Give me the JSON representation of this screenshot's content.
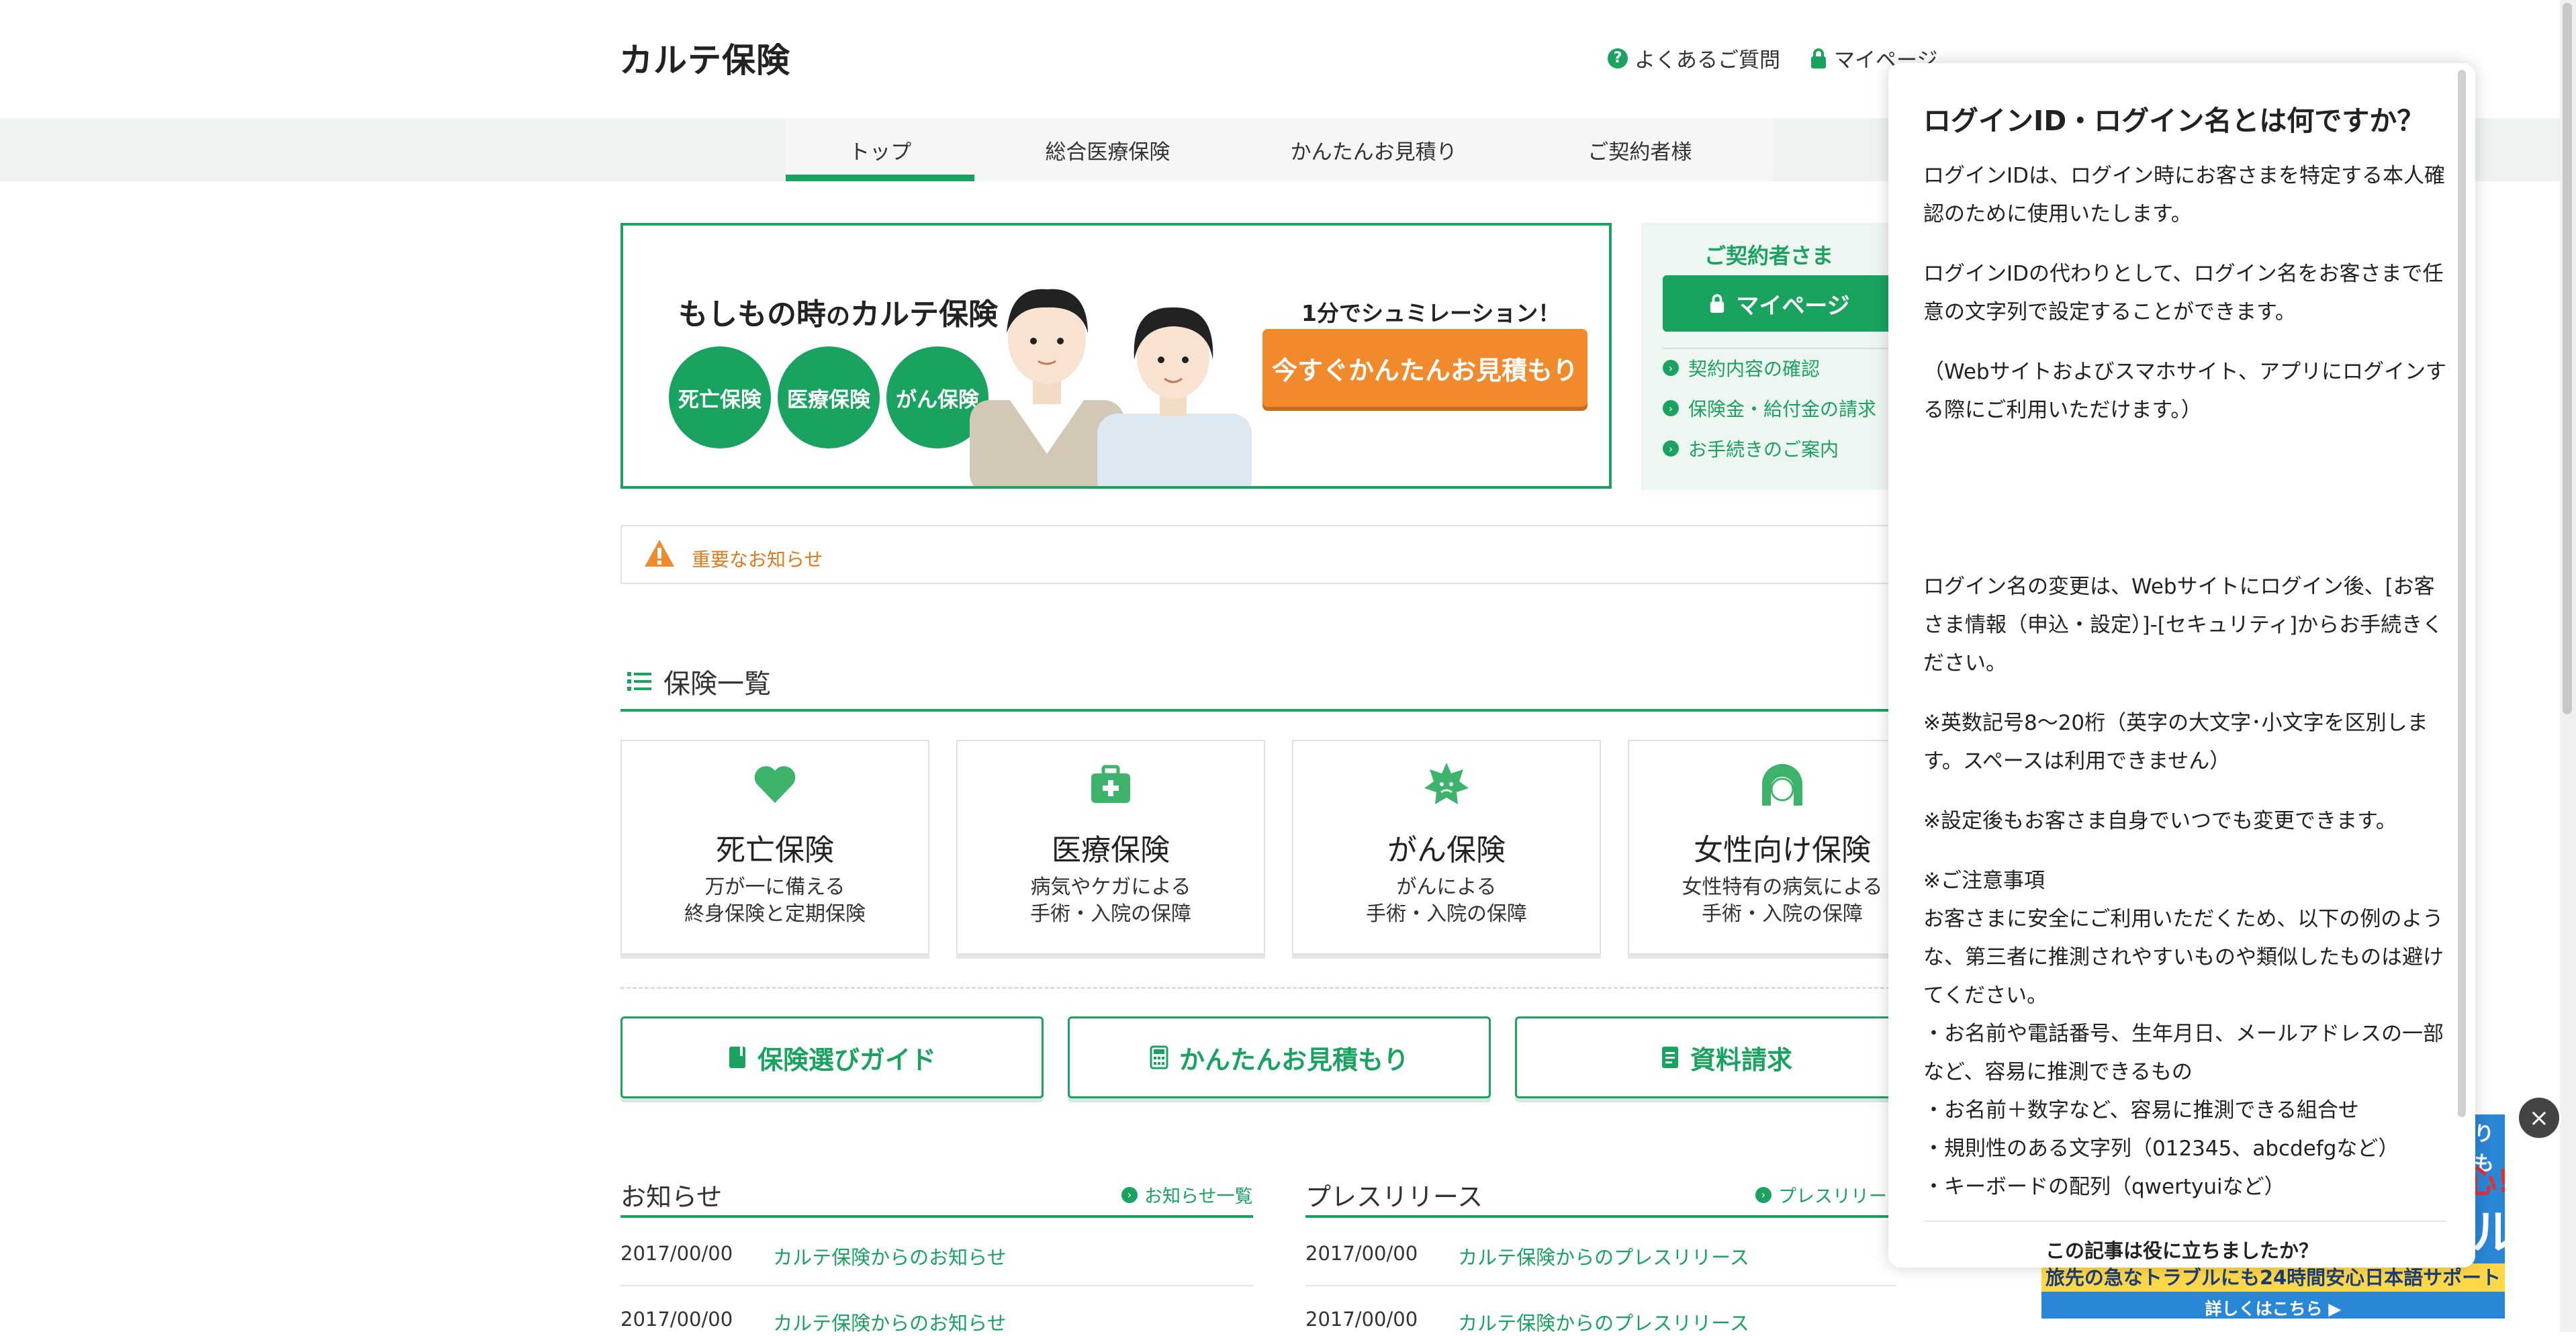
{
  "header": {
    "logo": "カルテ保険",
    "faq": "よくあるご質問",
    "mypage": "マイページ"
  },
  "nav": {
    "tabs": [
      "トップ",
      "総合医療保険",
      "かんたんお見積り",
      "ご契約者様"
    ],
    "active": "トップ"
  },
  "hero": {
    "title_a": "もしもの時",
    "title_b": "の",
    "title_c": "カルテ保険",
    "circles": [
      "死亡保険",
      "医療保険",
      "がん保険"
    ],
    "sim_label": "1分でシュミレーション！",
    "estimate_button": "今すぐかんたんお見積もり"
  },
  "member": {
    "title": "ご契約者さま",
    "mypage_button": "マイページ",
    "links": [
      "契約内容の確認",
      "保険金・給付金の請求",
      "お手続きのご案内"
    ]
  },
  "notice": {
    "text": "重要なお知らせ"
  },
  "insurance_list": {
    "title": "保険一覧",
    "cards": [
      {
        "icon": "heart-icon",
        "title": "死亡保険",
        "desc1": "万が一に備える",
        "desc2": "終身保険と定期保険"
      },
      {
        "icon": "medical-kit-icon",
        "title": "医療保険",
        "desc1": "病気やケガによる",
        "desc2": "手術・入院の保障"
      },
      {
        "icon": "cancer-icon",
        "title": "がん保険",
        "desc1": "がんによる",
        "desc2": "手術・入院の保障"
      },
      {
        "icon": "woman-icon",
        "title": "女性向け保険",
        "desc1": "女性特有の病気による",
        "desc2": "手術・入院の保障"
      }
    ]
  },
  "guides": [
    "保険選びガイド",
    "かんたんお見積もり",
    "資料請求"
  ],
  "news": {
    "title": "お知らせ",
    "more": "お知らせ一覧",
    "rows": [
      {
        "date": "2017/00/00",
        "text": "カルテ保険からのお知らせ"
      },
      {
        "date": "2017/00/00",
        "text": "カルテ保険からのお知らせ"
      }
    ]
  },
  "press": {
    "title": "プレスリリース",
    "more": "プレスリリース",
    "rows": [
      {
        "date": "2017/00/00",
        "text": "カルテ保険からのプレスリリース"
      },
      {
        "date": "2017/00/00",
        "text": "カルテ保険からのプレスリリース"
      }
    ]
  },
  "help_panel": {
    "title": "ログインID・ログイン名とは何ですか？",
    "p1": "ログインIDは、ログイン時にお客さまを特定する本人確認のために使用いたします。",
    "p2": "ログインIDの代わりとして、ログイン名をお客さまで任意の文字列で設定することができます。",
    "p3": "（Webサイトおよびスマホサイト、アプリにログインする際にご利用いただけます。）",
    "p4": "ログイン名の変更は、Webサイトにログイン後、[お客さま情報（申込・設定）]-[セキュリティ]からお手続きください。",
    "p5": "※英数記号8〜20桁（英字の大文字･小文字を区別します。スペースは利用できません）",
    "p6": "※設定後もお客さま自身でいつでも変更できます。",
    "caution_title": "※ご注意事項",
    "caution_body": "お客さまに安全にご利用いただくため、以下の例のような、第三者に推測されやすいものや類似したものは避けてください。",
    "bullets": [
      "・お名前や電話番号、生年月日、メールアドレスの一部など、容易に推測できるもの",
      "・お名前＋数字など、容易に推測できる組合せ",
      "・規則性のある文字列（012345、abcdefgなど）",
      "・キーボードの配列（qwertyuiなど）"
    ],
    "footer": "この記事は役に立ちましたか？"
  },
  "ad": {
    "strip": "旅先の急なトラブルにも24時間安心日本語サポート",
    "more": "詳しくはこちら ▶",
    "frag_top": "りも",
    "frag_red": "心!",
    "frag_big": "ル"
  },
  "colors": {
    "brand_green": "#1aa260",
    "orange": "#f08a2c"
  }
}
